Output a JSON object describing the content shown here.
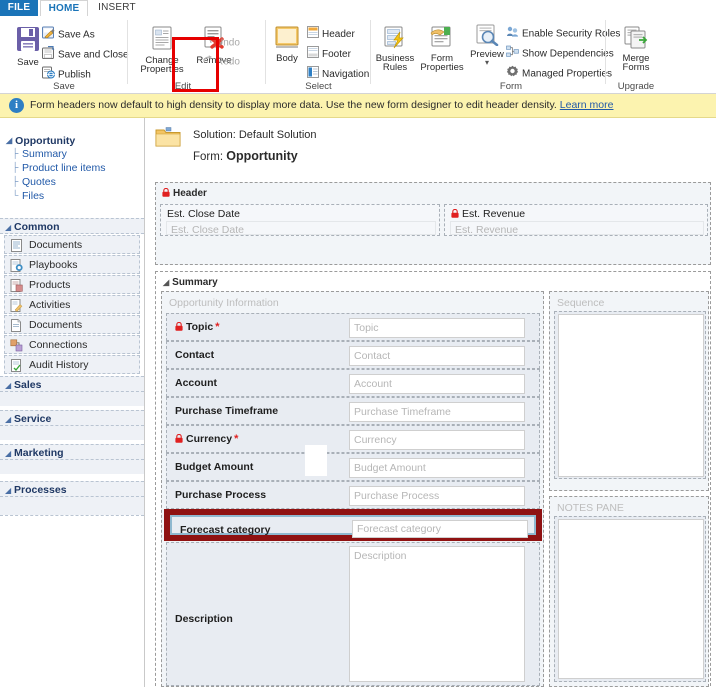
{
  "window": {
    "tabs": [
      {
        "id": "file",
        "label": "FILE"
      },
      {
        "id": "home",
        "label": "HOME"
      },
      {
        "id": "insert",
        "label": "INSERT"
      }
    ]
  },
  "ribbon": {
    "groups": [
      {
        "id": "save",
        "label": "Save",
        "big": {
          "label": "Save",
          "icon": "floppy-disk-icon"
        },
        "items": [
          {
            "label": "Save As",
            "icon": "save-as-icon",
            "disabled": false
          },
          {
            "label": "Save and Close",
            "icon": "save-and-close-icon",
            "disabled": false
          },
          {
            "label": "Publish",
            "icon": "publish-icon",
            "disabled": false
          }
        ]
      },
      {
        "id": "edit",
        "label": "Edit",
        "buttons": [
          {
            "label": "Change Properties",
            "icon": "change-properties-icon",
            "disabled": false
          },
          {
            "label": "Remove",
            "icon": "remove-icon",
            "disabled": false,
            "highlighted": true
          }
        ],
        "items": [
          {
            "label": "Undo",
            "icon": "undo-icon",
            "disabled": true
          },
          {
            "label": "Redo",
            "icon": "redo-icon",
            "disabled": true
          }
        ]
      },
      {
        "id": "select",
        "label": "Select",
        "big": {
          "label": "Body",
          "icon": "body-icon"
        },
        "items": [
          {
            "label": "Header",
            "icon": "header-icon",
            "disabled": false
          },
          {
            "label": "Footer",
            "icon": "footer-icon",
            "disabled": false
          },
          {
            "label": "Navigation",
            "icon": "navigation-icon",
            "disabled": false
          }
        ]
      },
      {
        "id": "form",
        "label": "Form",
        "buttons": [
          {
            "label": "Business Rules",
            "icon": "business-rules-icon"
          },
          {
            "label": "Form Properties",
            "icon": "form-properties-icon"
          },
          {
            "label": "Preview",
            "icon": "preview-icon",
            "hasDropdown": true
          }
        ],
        "items": [
          {
            "label": "Enable Security Roles",
            "icon": "security-roles-icon"
          },
          {
            "label": "Show Dependencies",
            "icon": "dependencies-icon"
          },
          {
            "label": "Managed Properties",
            "icon": "managed-properties-icon"
          }
        ]
      },
      {
        "id": "upgrade",
        "label": "Upgrade",
        "big": {
          "label": "Merge Forms",
          "icon": "merge-forms-icon"
        }
      }
    ]
  },
  "notification": {
    "icon": "info-icon",
    "glyph": "i",
    "text": "Form headers now default to high density to display more data. Use the new form designer to edit header density.",
    "link_label": "Learn more"
  },
  "left_nav": {
    "root": {
      "label": "Opportunity",
      "arrow": "◢"
    },
    "links": [
      {
        "label": "Summary"
      },
      {
        "label": "Product line items"
      },
      {
        "label": "Quotes"
      },
      {
        "label": "Files"
      }
    ],
    "sections": [
      {
        "label": "Common",
        "items": [
          {
            "label": "Documents",
            "icon": "document-icon"
          },
          {
            "label": "Playbooks",
            "icon": "playbook-icon"
          },
          {
            "label": "Products",
            "icon": "products-icon"
          },
          {
            "label": "Activities",
            "icon": "activities-icon"
          },
          {
            "label": "Documents",
            "icon": "documents-icon"
          },
          {
            "label": "Connections",
            "icon": "connections-icon"
          },
          {
            "label": "Audit History",
            "icon": "audit-history-icon"
          }
        ]
      },
      {
        "label": "Sales",
        "items": []
      },
      {
        "label": "Service",
        "items": []
      },
      {
        "label": "Marketing",
        "items": []
      },
      {
        "label": "Processes",
        "items": []
      }
    ]
  },
  "canvas": {
    "solution_label": "Solution: Default Solution",
    "form_prefix": "Form: ",
    "form_name": "Opportunity",
    "folder_icon": "folder-icon",
    "header_section": {
      "title": "Header",
      "locked": true,
      "fields": [
        {
          "label": "Est. Close Date",
          "placeholder": "Est. Close Date",
          "locked": false,
          "required": false
        },
        {
          "label": "Est. Revenue",
          "placeholder": "Est. Revenue",
          "locked": true,
          "required": false
        }
      ]
    },
    "summary_tab": {
      "title": "Summary",
      "arrow": "◢",
      "group_title": "Opportunity Information",
      "fields": [
        {
          "label": "Topic",
          "placeholder": "Topic",
          "locked": true,
          "required": true
        },
        {
          "label": "Contact",
          "placeholder": "Contact",
          "locked": false,
          "required": false
        },
        {
          "label": "Account",
          "placeholder": "Account",
          "locked": false,
          "required": false
        },
        {
          "label": "Purchase Timeframe",
          "placeholder": "Purchase Timeframe",
          "locked": false,
          "required": false
        },
        {
          "label": "Currency",
          "placeholder": "Currency",
          "locked": true,
          "required": true
        },
        {
          "label": "Budget Amount",
          "placeholder": "Budget Amount",
          "locked": false,
          "required": false
        },
        {
          "label": "Purchase Process",
          "placeholder": "Purchase Process",
          "locked": false,
          "required": false
        }
      ],
      "selected_field": {
        "label": "Forecast category",
        "placeholder": "Forecast category",
        "selected": true
      },
      "description_field": {
        "label": "Description",
        "placeholder": "Description"
      },
      "right_column": {
        "sequence_label": "Sequence",
        "notes_pane_label": "NOTES PANE"
      }
    }
  },
  "colors": {
    "accent_blue": "#1a74b8",
    "notification_bg": "#fcf3af",
    "highlight_red": "#e60000",
    "annotation_red": "#8f1212",
    "selection_blue": "#8fb8cf",
    "required_red": "#e02020",
    "link_blue": "#2159a8",
    "nav_header": "#1f3864"
  }
}
